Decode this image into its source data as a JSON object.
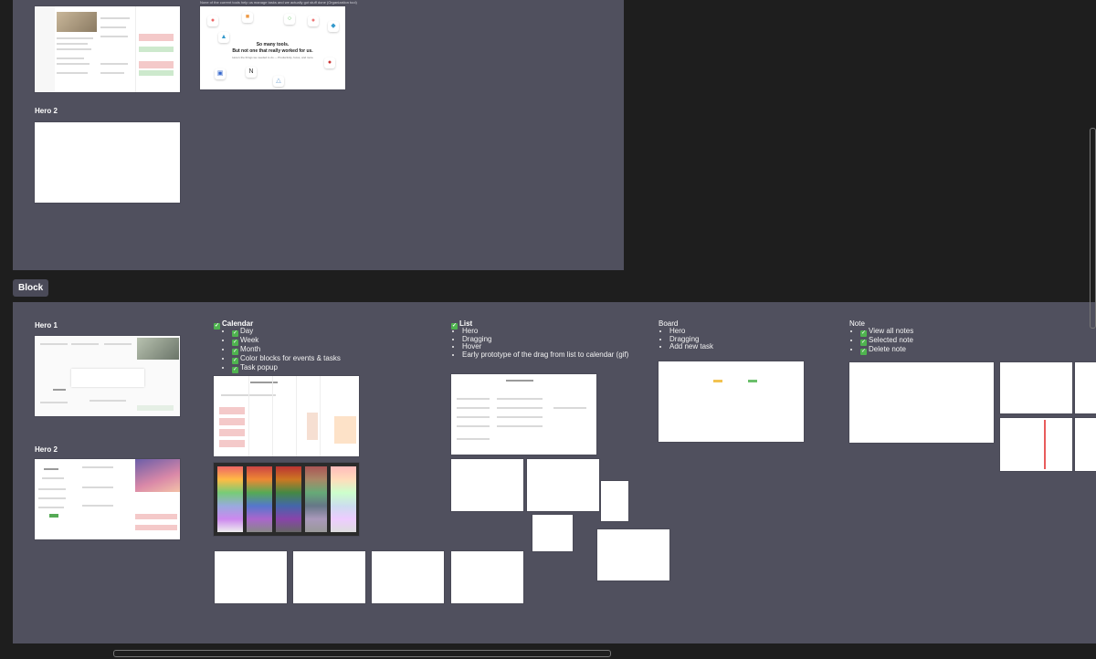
{
  "canvas": {
    "section_label": "Block",
    "top_note": "None of the current tools help us manage tasks and we actually got stuff done (Organization tool)"
  },
  "top_section": {
    "hero2_label": "Hero 2",
    "promo": {
      "headline1": "So many tools.",
      "headline2": "But not one that really worked for us.",
      "sub": "Here's the things we needed to do — Productivity, focus, and more"
    }
  },
  "block_section": {
    "hero1_label": "Hero 1",
    "hero2_label": "Hero 2",
    "calendar": {
      "title": "Calendar",
      "items": [
        "Day",
        "Week",
        "Month",
        "Color blocks for events & tasks",
        "Task popup"
      ]
    },
    "list": {
      "title": "List",
      "items": [
        "Hero",
        "Dragging",
        "Hover",
        "Early prototype of the drag from list to calendar (gif)"
      ]
    },
    "board": {
      "title": "Board",
      "items": [
        "Hero",
        "Dragging",
        "Add new task"
      ]
    },
    "note": {
      "title": "Note",
      "items": [
        "View all notes",
        "Selected note",
        "Delete note"
      ]
    }
  },
  "colors": {
    "canvas_bg": "#1e1e1e",
    "section_bg": "#50505e",
    "check_green": "#4fb34f",
    "accent_red": "#e85c5c"
  }
}
